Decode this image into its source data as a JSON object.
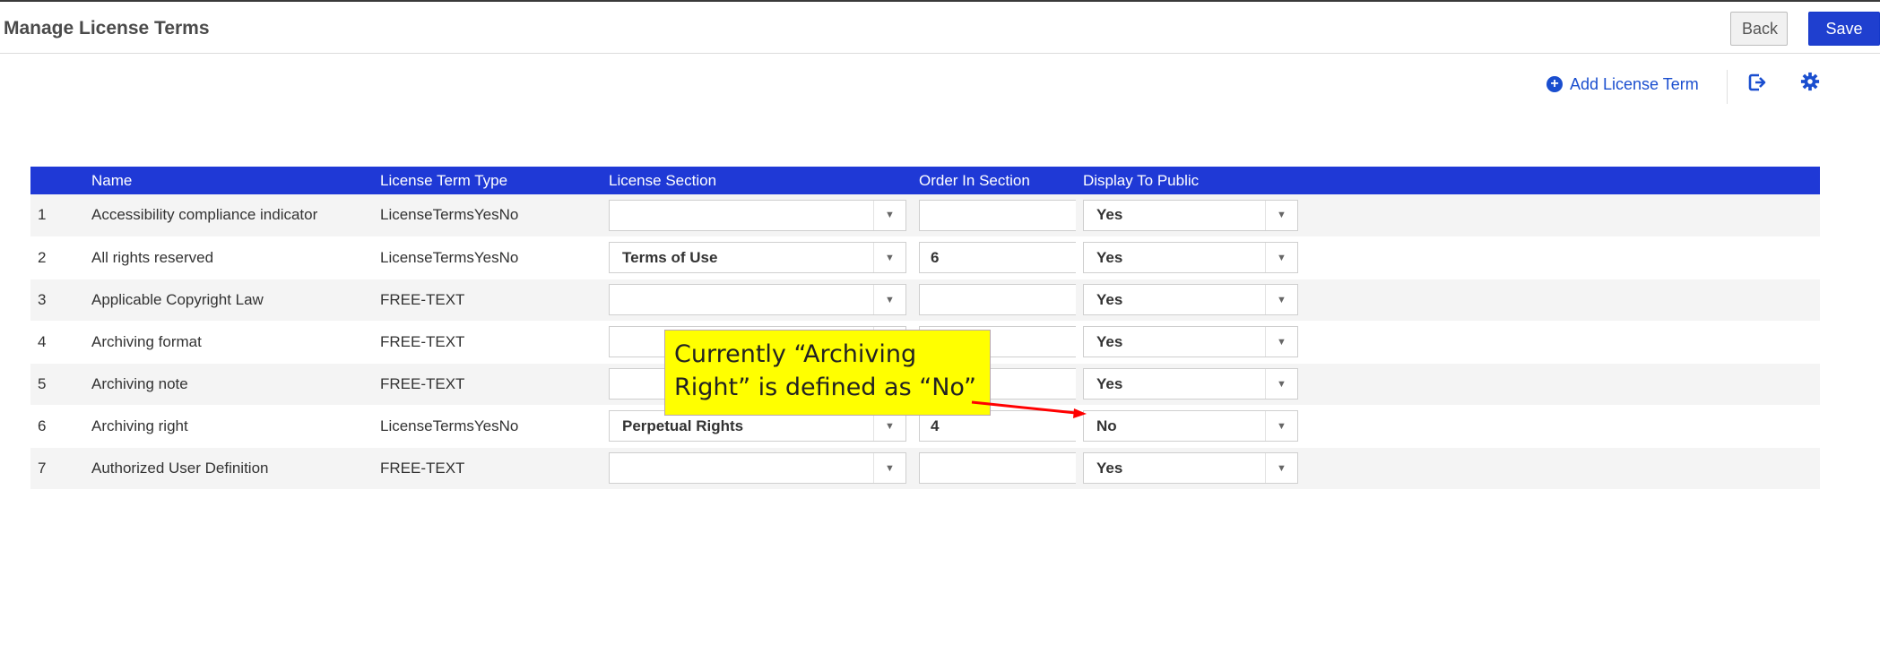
{
  "header": {
    "title": "Manage License Terms",
    "back_label": "Back",
    "save_label": "Save"
  },
  "toolbar": {
    "add_label": "Add License Term"
  },
  "table": {
    "columns": [
      "",
      "Name",
      "License Term Type",
      "License Section",
      "Order In Section",
      "Display To Public"
    ],
    "rows": [
      {
        "num": "1",
        "name": "Accessibility compliance indicator",
        "type": "LicenseTermsYesNo",
        "section": "",
        "order": "",
        "display": "Yes"
      },
      {
        "num": "2",
        "name": "All rights reserved",
        "type": "LicenseTermsYesNo",
        "section": "Terms of Use",
        "order": "6",
        "display": "Yes"
      },
      {
        "num": "3",
        "name": "Applicable Copyright Law",
        "type": "FREE-TEXT",
        "section": "",
        "order": "",
        "display": "Yes"
      },
      {
        "num": "4",
        "name": "Archiving format",
        "type": "FREE-TEXT",
        "section": "",
        "order": "",
        "display": "Yes"
      },
      {
        "num": "5",
        "name": "Archiving note",
        "type": "FREE-TEXT",
        "section": "",
        "order": "",
        "display": "Yes"
      },
      {
        "num": "6",
        "name": "Archiving right",
        "type": "LicenseTermsYesNo",
        "section": "Perpetual Rights",
        "order": "4",
        "display": "No"
      },
      {
        "num": "7",
        "name": "Authorized User Definition",
        "type": "FREE-TEXT",
        "section": "",
        "order": "",
        "display": "Yes"
      }
    ]
  },
  "callout": {
    "line1": "Currently “Archiving",
    "line2": "Right” is defined as “No”"
  },
  "colors": {
    "accent": "#1f39d6",
    "save": "#1f3fcf",
    "callout": "#ffff00",
    "arrow": "#ff0000"
  }
}
